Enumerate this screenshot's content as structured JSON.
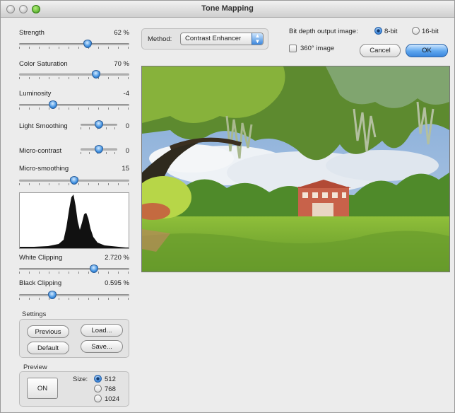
{
  "window": {
    "title": "Tone Mapping"
  },
  "sliders": [
    {
      "id": "strength",
      "label": "Strength",
      "value_text": "62 %",
      "level": 0.62
    },
    {
      "id": "color-saturation",
      "label": "Color Saturation",
      "value_text": "70 %",
      "level": 0.7
    },
    {
      "id": "luminosity",
      "label": "Luminosity",
      "value_text": "-4",
      "level": 0.31
    },
    {
      "id": "light-smoothing",
      "label": "Light Smoothing",
      "value_text": "0",
      "level": 0.5
    },
    {
      "id": "micro-contrast",
      "label": "Micro-contrast",
      "value_text": "0",
      "level": 0.5
    },
    {
      "id": "micro-smoothing",
      "label": "Micro-smoothing",
      "value_text": "15",
      "level": 0.5
    },
    {
      "id": "white-clipping",
      "label": "White Clipping",
      "value_text": "2.720 %",
      "level": 0.68
    },
    {
      "id": "black-clipping",
      "label": "Black Clipping",
      "value_text": "0.595 %",
      "level": 0.3
    }
  ],
  "method": {
    "label": "Method:",
    "selected": "Contrast Enhancer"
  },
  "bit_depth": {
    "label": "Bit depth output image:",
    "options": [
      "8-bit",
      "16-bit"
    ],
    "selected": "8-bit"
  },
  "image360": {
    "label": "360° image",
    "checked": false
  },
  "buttons": {
    "cancel": "Cancel",
    "ok": "OK"
  },
  "settings": {
    "title": "Settings",
    "previous": "Previous",
    "load": "Load...",
    "default": "Default",
    "save": "Save..."
  },
  "preview": {
    "title": "Preview",
    "on_button": "ON",
    "size_label": "Size:",
    "sizes": [
      "512",
      "768",
      "1024"
    ],
    "selected_size": "512"
  },
  "colors": {
    "accent": "#3a86dc",
    "window_bg": "#ececec"
  }
}
